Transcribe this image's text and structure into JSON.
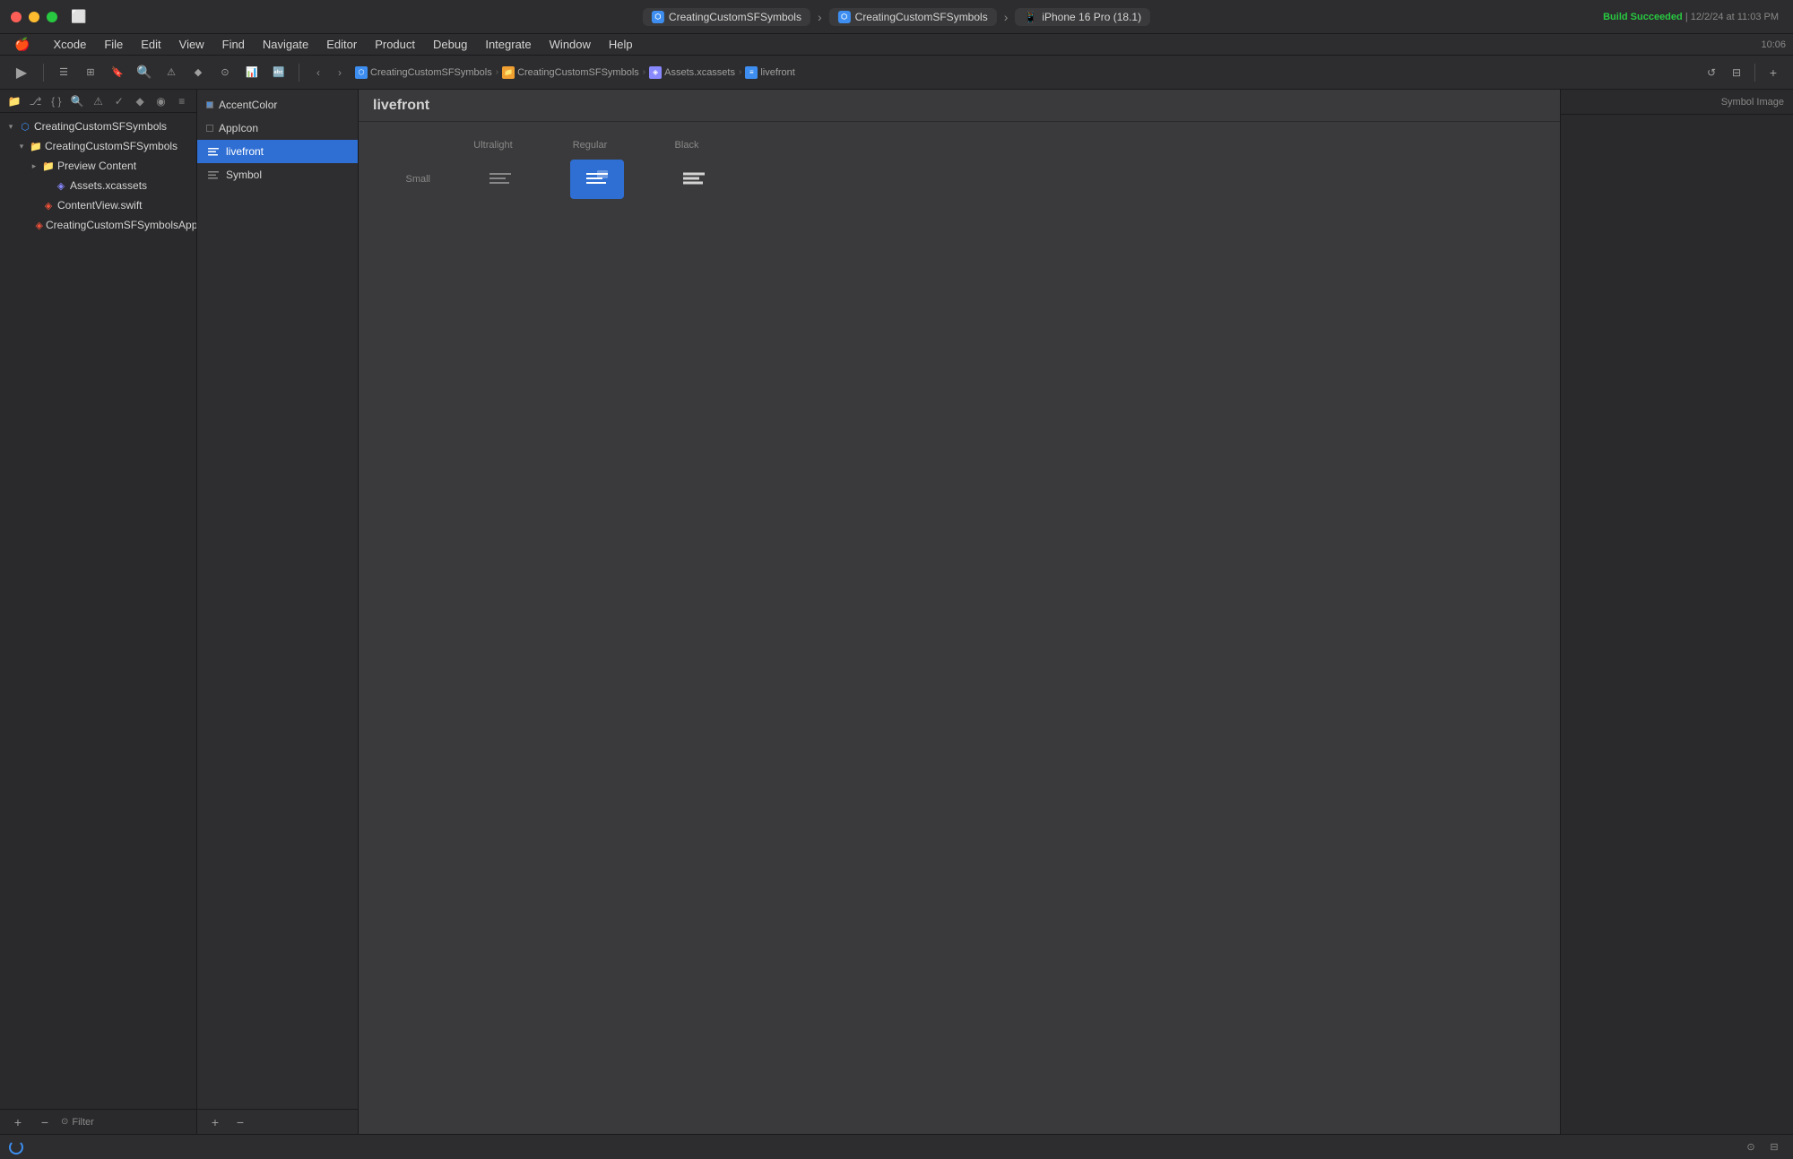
{
  "app": {
    "name": "Xcode",
    "time": "10:06"
  },
  "menu": {
    "items": [
      "Xcode",
      "File",
      "Edit",
      "View",
      "Find",
      "Navigate",
      "Editor",
      "Product",
      "Debug",
      "Integrate",
      "Window",
      "Help"
    ]
  },
  "titlebar": {
    "project_tab": "CreatingCustomSFSymbols",
    "source_tab": "CreatingCustomSFSymbols",
    "device_tab": "iPhone 16 Pro (18.1)",
    "build_status": "Build Succeeded",
    "build_date": "12/2/24 at 11:03 PM"
  },
  "breadcrumb": {
    "items": [
      "CreatingCustomSFSymbols",
      "CreatingCustomSFSymbols",
      "Assets.xcassets",
      "livefront"
    ]
  },
  "sidebar": {
    "items": [
      {
        "label": "CreatingCustomSFSymbols",
        "indent": 0,
        "type": "project",
        "expanded": true
      },
      {
        "label": "CreatingCustomSFSymbols",
        "indent": 1,
        "type": "folder",
        "expanded": true
      },
      {
        "label": "Preview Content",
        "indent": 2,
        "type": "folder",
        "expanded": true
      },
      {
        "label": "Assets.xcassets",
        "indent": 3,
        "type": "xcassets"
      },
      {
        "label": "ContentView.swift",
        "indent": 2,
        "type": "swift"
      },
      {
        "label": "CreatingCustomSFSymbolsApp...",
        "indent": 2,
        "type": "swift"
      }
    ],
    "filter_placeholder": "Filter"
  },
  "asset_catalog": {
    "items": [
      {
        "label": "AccentColor",
        "type": "color"
      },
      {
        "label": "AppIcon",
        "type": "appicon"
      },
      {
        "label": "livefront",
        "type": "symbol",
        "selected": true
      },
      {
        "label": "Symbol",
        "type": "symbol"
      }
    ]
  },
  "symbol_view": {
    "title": "livefront",
    "weights": [
      "Ultralight",
      "Regular",
      "Black"
    ],
    "sizes": [
      "Small"
    ],
    "inspector_label": "Symbol Image"
  }
}
